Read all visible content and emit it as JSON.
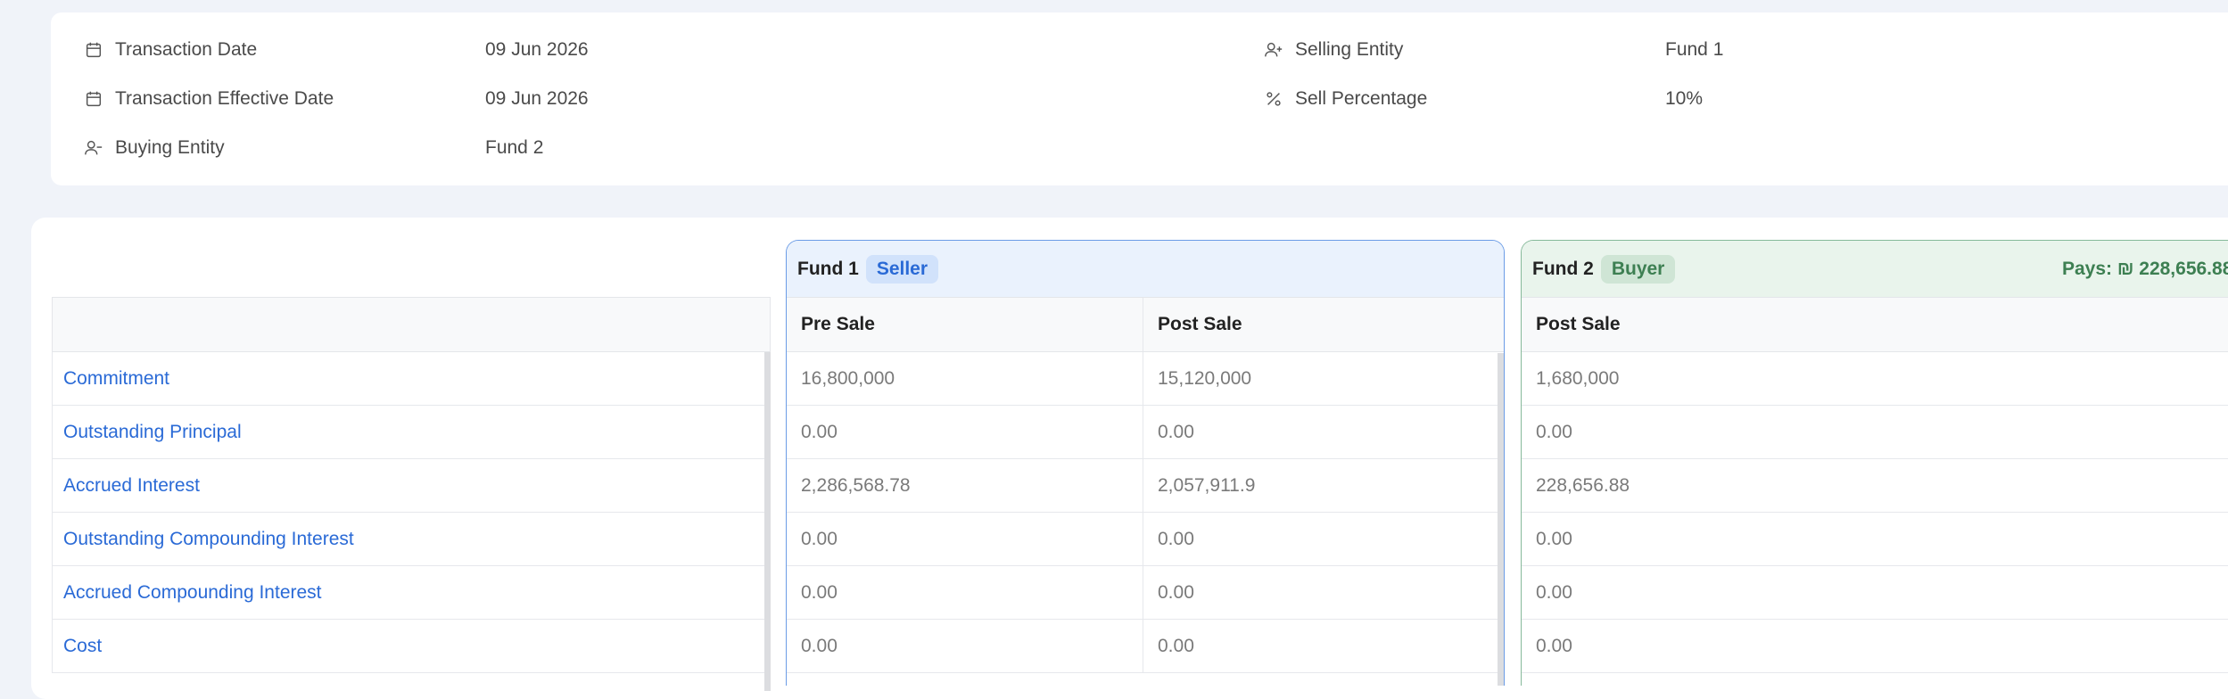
{
  "info": {
    "transaction_date_label": "Transaction Date",
    "transaction_date_value": "09 Jun 2026",
    "effective_date_label": "Transaction Effective Date",
    "effective_date_value": "09 Jun 2026",
    "buying_entity_label": "Buying Entity",
    "buying_entity_value": "Fund 2",
    "selling_entity_label": "Selling Entity",
    "selling_entity_value": "Fund 1",
    "sell_percentage_label": "Sell Percentage",
    "sell_percentage_value": "10%"
  },
  "rows": [
    "Commitment",
    "Outstanding Principal",
    "Accrued Interest",
    "Outstanding Compounding Interest",
    "Accrued Compounding Interest",
    "Cost"
  ],
  "fund1": {
    "name": "Fund 1",
    "role": "Seller",
    "columns": [
      "Pre Sale",
      "Post Sale"
    ],
    "pre_sale": [
      "16,800,000",
      "0.00",
      "2,286,568.78",
      "0.00",
      "0.00",
      "0.00"
    ],
    "post_sale": [
      "15,120,000",
      "0.00",
      "2,057,911.9",
      "0.00",
      "0.00",
      "0.00"
    ]
  },
  "fund2": {
    "name": "Fund 2",
    "role": "Buyer",
    "pays": "Pays: ₪ 228,656.88",
    "columns": [
      "Post Sale"
    ],
    "post_sale": [
      "1,680,000",
      "0.00",
      "228,656.88",
      "0.00",
      "0.00",
      "0.00"
    ]
  },
  "colors": {
    "accent_blue": "#2a6ad6",
    "accent_green": "#3d7f52"
  }
}
